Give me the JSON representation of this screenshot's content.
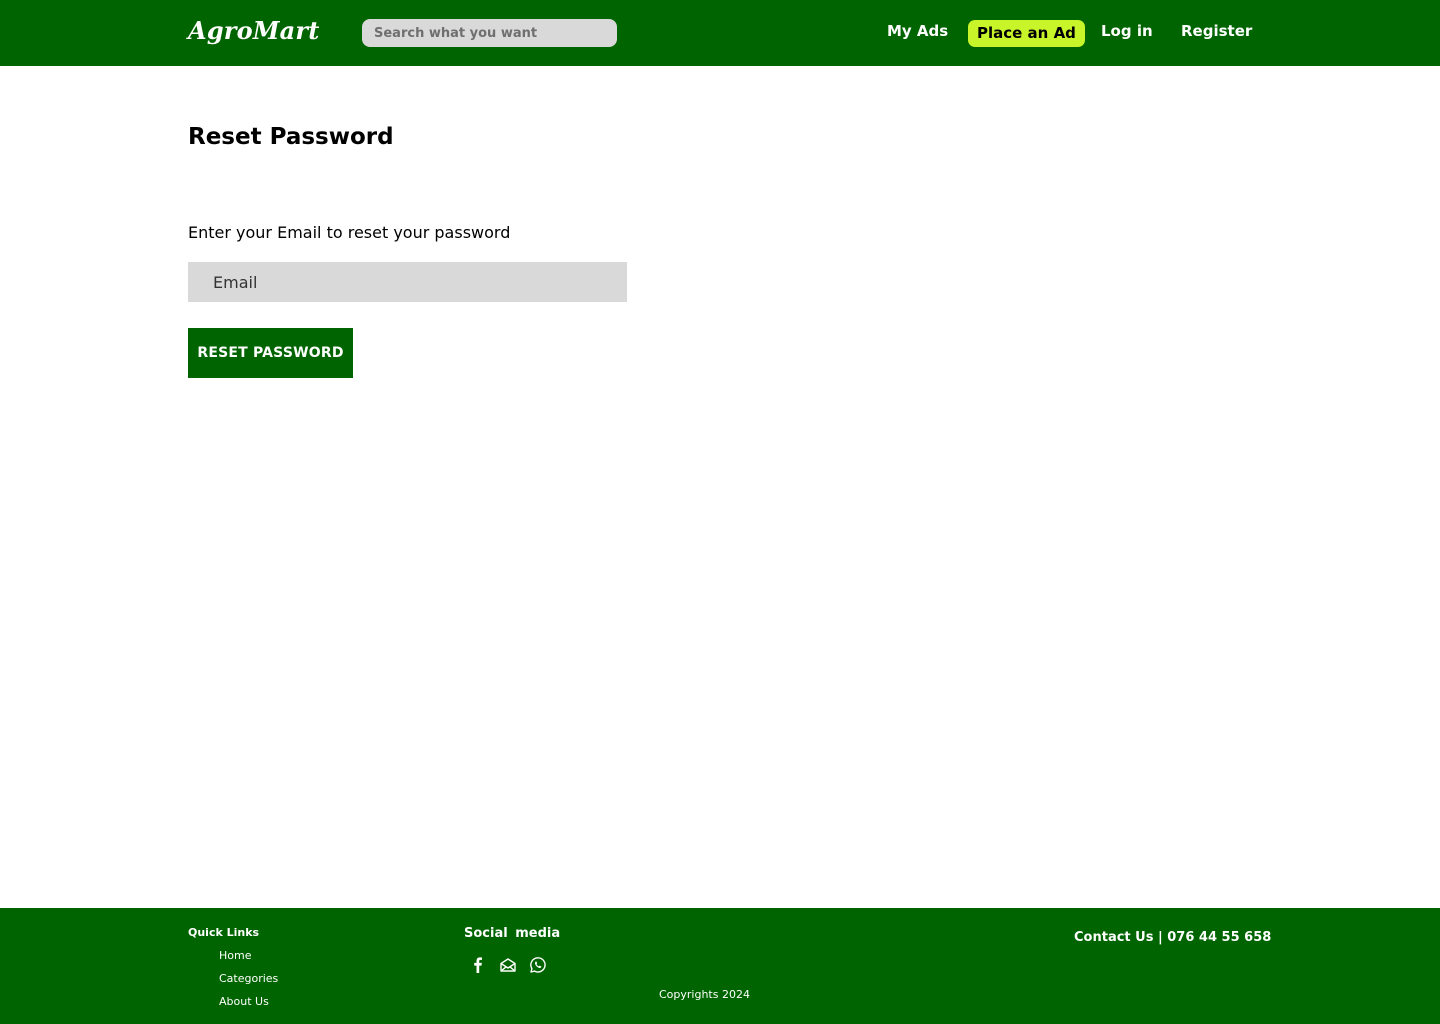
{
  "header": {
    "logo": "AgroMart",
    "search_placeholder": "Search what you want",
    "nav": {
      "my_ads": "My Ads",
      "place_ad": "Place an Ad",
      "login": "Log in",
      "register": "Register"
    }
  },
  "main": {
    "title": "Reset Password",
    "instruction": "Enter your Email to reset your password",
    "email_placeholder": "Email",
    "reset_button": "RESET PASSWORD"
  },
  "footer": {
    "quick_links_title": "Quick Links",
    "quick_links": [
      "Home",
      "Categories",
      "About Us"
    ],
    "social_title": "Social  media",
    "social_icons": [
      "facebook-icon",
      "mail-icon",
      "whatsapp-icon"
    ],
    "copyright": "Copyrights 2024",
    "contact": "Contact Us | 076 44 55 658"
  },
  "colors": {
    "primary_green": "#006400",
    "accent_lime": "#c8f52a",
    "input_gray": "#d9d9d9"
  }
}
